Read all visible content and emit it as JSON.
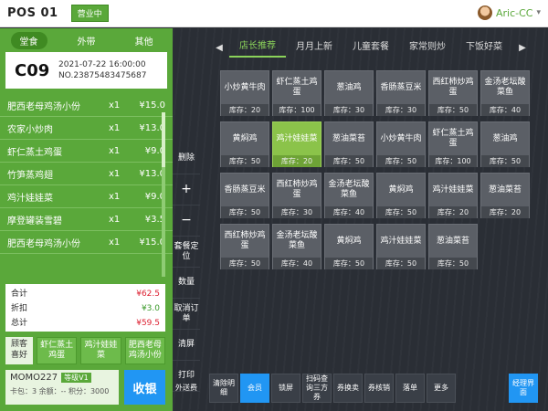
{
  "header": {
    "title": "POS 01",
    "status": "营业中",
    "user": "Aric-CC"
  },
  "order": {
    "tabs": [
      "堂食",
      "外带",
      "其他"
    ],
    "table_no": "C09",
    "datetime": "2021-07-22 16:00:00",
    "order_no": "NO.23875483475687",
    "items": [
      {
        "name": "肥西老母鸡汤小份",
        "qty": "x1",
        "price": "¥15.0"
      },
      {
        "name": "农家小炒肉",
        "qty": "x1",
        "price": "¥13.0"
      },
      {
        "name": "虾仁蒸土鸡蛋",
        "qty": "x1",
        "price": "¥9.0"
      },
      {
        "name": "竹笋蒸鸡翅",
        "qty": "x1",
        "price": "¥13.0"
      },
      {
        "name": "鸡汁娃娃菜",
        "qty": "x1",
        "price": "¥9.0"
      },
      {
        "name": "摩登罐装雪碧",
        "qty": "x1",
        "price": "¥3.5"
      },
      {
        "name": "肥西老母鸡汤小份",
        "qty": "x1",
        "price": "¥15.0"
      }
    ],
    "totals": [
      {
        "label": "合计",
        "value": "¥62.5"
      },
      {
        "label": "折扣",
        "value": "¥3.0"
      },
      {
        "label": "总计",
        "value": "¥59.5"
      }
    ],
    "quick_label": "顾客喜好",
    "quick_items": [
      "虾仁蒸土鸡蛋",
      "鸡汁娃娃菜",
      "肥西老母鸡汤小份"
    ],
    "member": {
      "id": "MOMO227",
      "level": "等级V1",
      "card": "卡包：3",
      "balance": "余额：--",
      "points": "积分：3000"
    },
    "pay_label": "收银"
  },
  "menu": {
    "categories": [
      "店长推荐",
      "月月上新",
      "儿童套餐",
      "家常则炒",
      "下饭好菜"
    ],
    "side_ops": [
      "删除",
      "+",
      "−",
      "套餐定位",
      "数量",
      "取消订单",
      "清屏",
      "打印"
    ],
    "dishes": [
      {
        "name": "小炒黄牛肉",
        "stock": "库存：20"
      },
      {
        "name": "虾仁蒸土鸡蛋",
        "stock": "库存：100"
      },
      {
        "name": "葱油鸡",
        "stock": "库存：30"
      },
      {
        "name": "香肠蒸豆米",
        "stock": "库存：30"
      },
      {
        "name": "西红柿炒鸡蛋",
        "stock": "库存：50"
      },
      {
        "name": "金汤老坛酸菜鱼",
        "stock": "库存：40"
      },
      {
        "name": "黄焖鸡",
        "stock": "库存：50"
      },
      {
        "name": "鸡汁娃娃菜",
        "stock": "库存：20"
      },
      {
        "name": "葱油菜苔",
        "stock": "库存：50"
      },
      {
        "name": "小炒黄牛肉",
        "stock": "库存：50"
      },
      {
        "name": "虾仁蒸土鸡蛋",
        "stock": "库存：100"
      },
      {
        "name": "葱油鸡",
        "stock": "库存：50"
      },
      {
        "name": "香肠蒸豆米",
        "stock": "库存：50"
      },
      {
        "name": "西红柿炒鸡蛋",
        "stock": "库存：30"
      },
      {
        "name": "金汤老坛酸菜鱼",
        "stock": "库存：40"
      },
      {
        "name": "黄焖鸡",
        "stock": "库存：50"
      },
      {
        "name": "鸡汁娃娃菜",
        "stock": "库存：20"
      },
      {
        "name": "葱油菜苔",
        "stock": "库存：20"
      },
      {
        "name": "西红柿炒鸡蛋",
        "stock": "库存：50"
      },
      {
        "name": "金汤老坛酸菜鱼",
        "stock": "库存：40"
      },
      {
        "name": "黄焖鸡",
        "stock": "库存：50"
      },
      {
        "name": "鸡汁娃娃菜",
        "stock": "库存：50"
      },
      {
        "name": "葱油菜苔",
        "stock": "库存：50"
      }
    ],
    "selected_index": 7,
    "bottom_ops": [
      "外送费",
      "清除明细",
      "会员",
      "锁屏",
      "扫码查询三方券",
      "券换卖",
      "券核销",
      "落单",
      "更多",
      "经理界面"
    ]
  }
}
